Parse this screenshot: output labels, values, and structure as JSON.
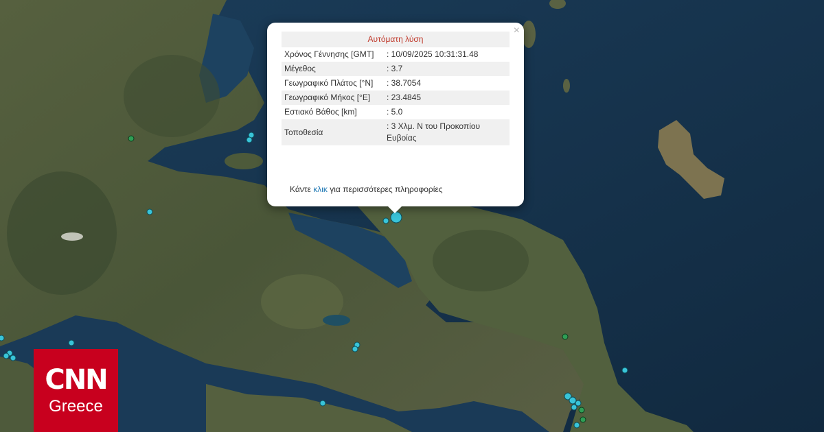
{
  "popup": {
    "title": "Αυτόματη λύση",
    "rows": [
      {
        "label": "Χρόνος Γέννησης [GMT]",
        "value": ": 10/09/2025 10:31:31.48"
      },
      {
        "label": "Μέγεθος",
        "value": ": 3.7"
      },
      {
        "label": "Γεωγραφικό Πλάτος [°N]",
        "value": ": 38.7054"
      },
      {
        "label": "Γεωγραφικό Μήκος [°E]",
        "value": ": 23.4845"
      },
      {
        "label": "Εστιακό Βάθος [km]",
        "value": ": 5.0"
      },
      {
        "label": "Τοποθεσία",
        "value": ": 3 Χλμ. Ν του Προκοπίου Ευβοίας"
      }
    ],
    "more_prefix": "Κάντε",
    "more_link": "κλικ",
    "more_suffix": "για περισσότερες πληροφορίες",
    "close_symbol": "×"
  },
  "logo": {
    "brand": "CNN",
    "region": "Greece"
  },
  "colors": {
    "sea": "#16344f",
    "land": "#4f5c3a",
    "marker_cyan": "#39c4d8",
    "marker_green": "#2f9e55",
    "logo_red": "#c8001e",
    "popup_title": "#c0392b"
  }
}
